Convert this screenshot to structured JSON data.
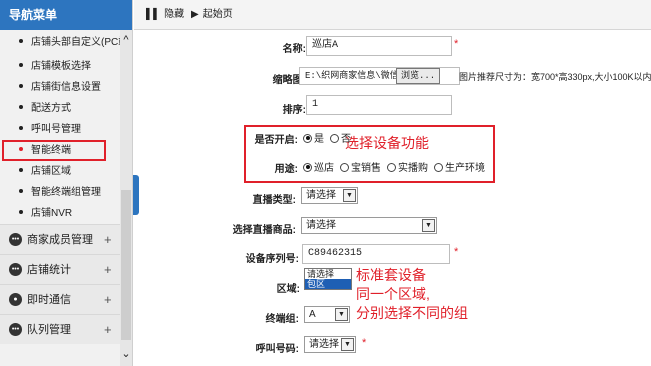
{
  "sidebar": {
    "title": "导航菜单",
    "sub_items": [
      {
        "label": "店铺头部自定义(PC端)"
      },
      {
        "label": "店铺模板选择"
      },
      {
        "label": "店铺街信息设置"
      },
      {
        "label": "配送方式"
      },
      {
        "label": "呼叫号管理"
      },
      {
        "label": "智能终端"
      },
      {
        "label": "店铺区域"
      },
      {
        "label": "智能终端组管理"
      },
      {
        "label": "店铺NVR"
      }
    ],
    "groups": [
      {
        "label": "商家成员管理",
        "icon": "chat-bubble-icon"
      },
      {
        "label": "店铺统计",
        "icon": "chat-bubble-icon"
      },
      {
        "label": "即时通信",
        "icon": "user-icon"
      },
      {
        "label": "队列管理",
        "icon": "chat-bubble-icon"
      }
    ],
    "plus": "+"
  },
  "toolbar": {
    "hide_label": "隐藏",
    "home_label": "起始页"
  },
  "form": {
    "name": {
      "label": "名称:",
      "value": "巡店A",
      "required": "*"
    },
    "thumbnail": {
      "label": "缩略图:",
      "path": "E:\\织网商家信息\\微信图片",
      "browse": "浏览...",
      "hint": "图片推荐尺寸为：宽700*高330px,大小100K以内"
    },
    "sort": {
      "label": "排序:",
      "value": "1"
    },
    "enabled": {
      "label": "是否开启:",
      "options": [
        "是",
        "否"
      ],
      "selected": "是"
    },
    "purpose": {
      "label": "用途:",
      "options": [
        "巡店",
        "宝销售",
        "实播购",
        "生产环境"
      ],
      "selected": "巡店"
    },
    "live_type": {
      "label": "直播类型:",
      "value": "请选择"
    },
    "live_product": {
      "label": "选择直播商品:",
      "value": "请选择"
    },
    "serial": {
      "label": "设备序列号:",
      "value": "C89462315",
      "required": "*"
    },
    "area": {
      "label": "区域:",
      "options": [
        "请选择",
        "包区"
      ],
      "selected": "包区"
    },
    "terminal_group": {
      "label": "终端组:",
      "value": "A"
    },
    "call_number": {
      "label": "呼叫号码:",
      "value": "请选择",
      "required": "*"
    }
  },
  "annotations": {
    "select_device_function": "选择设备功能",
    "line1": "标准套设备",
    "line2": "同一个区域,",
    "line3": "分别选择不同的组"
  },
  "colors": {
    "brand_blue": "#2d75bf",
    "annotation_red": "#e0202a"
  }
}
